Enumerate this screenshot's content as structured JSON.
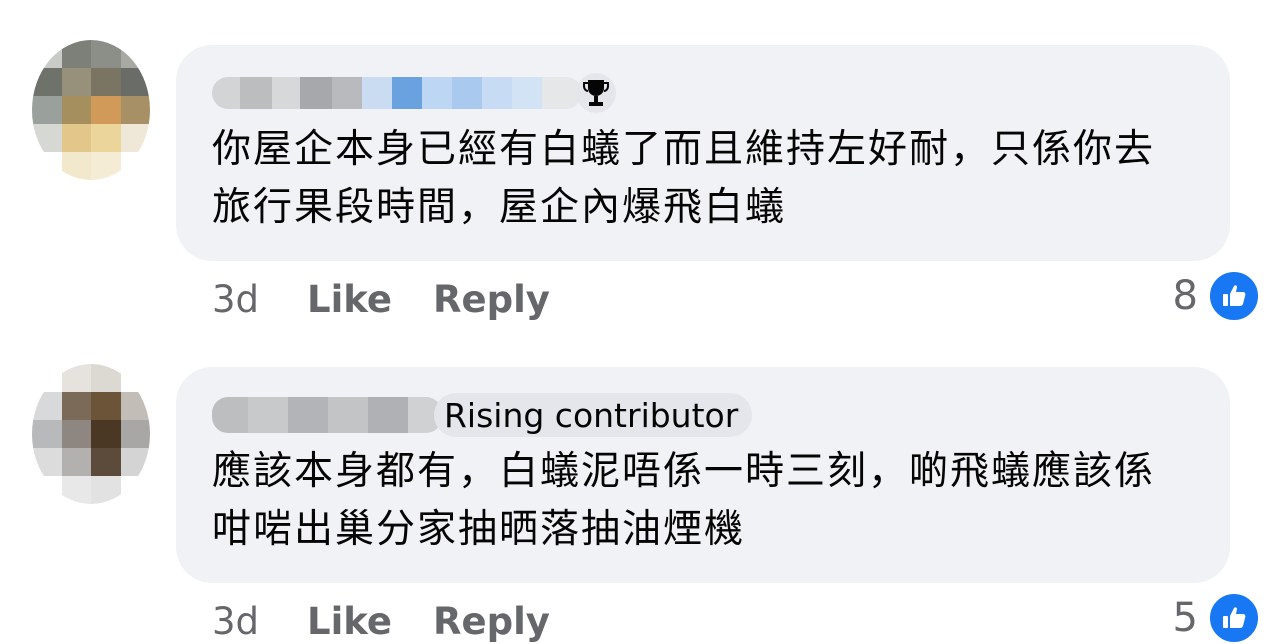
{
  "comments": [
    {
      "badge": "",
      "text": "你屋企本身已經有白蟻了而且維持左好耐，只係你去旅行果段時間，屋企內爆飛白蟻",
      "time": "3d",
      "like_label": "Like",
      "reply_label": "Reply",
      "reaction_count": "8",
      "badge_icon": "trophy-icon"
    },
    {
      "badge": "Rising contributor",
      "text": "應該本身都有，白蟻泥唔係一時三刻，啲飛蟻應該係咁啱出巢分家抽晒落抽油煙機",
      "time": "3d",
      "like_label": "Like",
      "reply_label": "Reply",
      "reaction_count": "5"
    }
  ],
  "colors": {
    "bubble": "#f0f2f5",
    "meta_text": "#65676b",
    "like_blue": "#1877f2"
  }
}
